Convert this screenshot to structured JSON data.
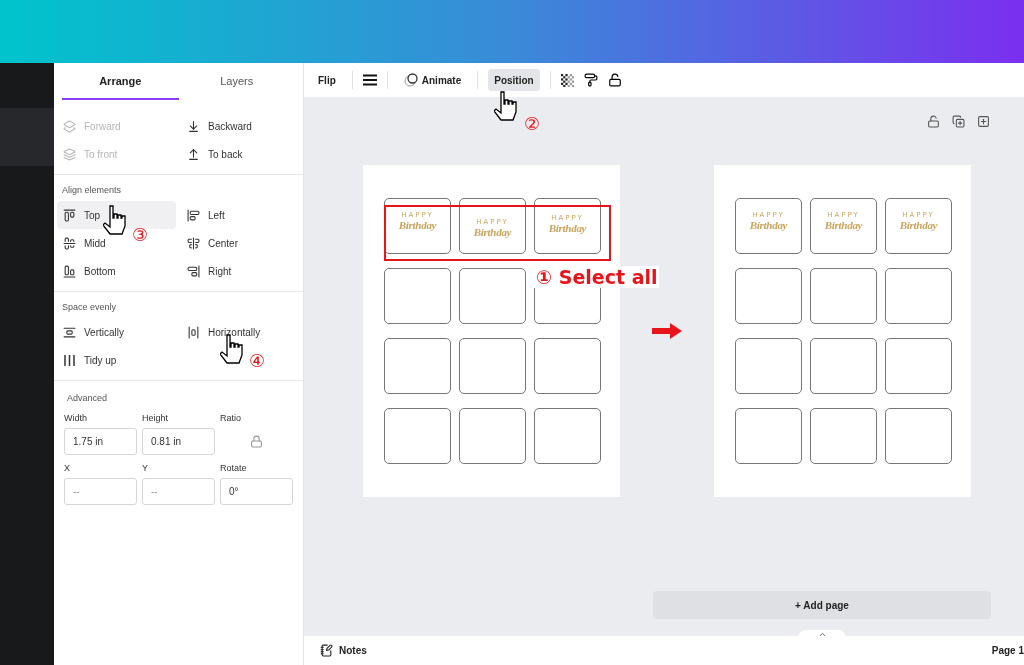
{
  "tabs": [
    {
      "label": "Arrange",
      "selected": true
    },
    {
      "label": "Layers",
      "selected": false
    }
  ],
  "order_actions": [
    {
      "label": "Forward",
      "disabled": true
    },
    {
      "label": "Backward",
      "disabled": false
    },
    {
      "label": "To front",
      "disabled": true
    },
    {
      "label": "To back",
      "disabled": false
    }
  ],
  "align_elements": {
    "title": "Align elements",
    "items": [
      {
        "label": "Top",
        "selected": true
      },
      {
        "label": "Left",
        "selected": false
      },
      {
        "label": "Midd",
        "selected": false
      },
      {
        "label": "Center",
        "selected": false
      },
      {
        "label": "Bottom",
        "selected": false
      },
      {
        "label": "Right",
        "selected": false
      }
    ]
  },
  "space_evenly": {
    "title": "Space evenly",
    "items": [
      {
        "label": "Vertically"
      },
      {
        "label": "Horizontally"
      },
      {
        "label": "Tidy up"
      }
    ]
  },
  "advanced": {
    "title": "Advanced",
    "fields": [
      {
        "kind": "input",
        "label": "Width",
        "value": "1.75 in"
      },
      {
        "kind": "input",
        "label": "Height",
        "value": "0.81 in"
      },
      {
        "kind": "lock",
        "label": "Ratio"
      },
      {
        "kind": "input",
        "label": "X",
        "placeholder": "--"
      },
      {
        "kind": "input",
        "label": "Y",
        "placeholder": "--"
      },
      {
        "kind": "input",
        "label": "Rotate",
        "value": "0°"
      }
    ]
  },
  "toolbar": {
    "flip": "Flip",
    "animate": "Animate",
    "position": {
      "label": "Position",
      "selected": true
    }
  },
  "pages": [
    {
      "selection_box": true,
      "aligned": false,
      "annotation": "① Select all",
      "rows": [
        [
          {
            "kind": "label",
            "top_text": "HAPPY",
            "main_text": "Birthday"
          },
          {
            "kind": "label",
            "top_text": "HAPPY",
            "main_text": "Birthday"
          },
          {
            "kind": "label",
            "top_text": "HAPPY",
            "main_text": "Birthday"
          }
        ],
        [
          {
            "kind": "empty"
          },
          {
            "kind": "empty"
          },
          {
            "kind": "empty"
          }
        ],
        [
          {
            "kind": "empty"
          },
          {
            "kind": "empty"
          },
          {
            "kind": "empty"
          }
        ],
        [
          {
            "kind": "empty"
          },
          {
            "kind": "empty"
          },
          {
            "kind": "empty"
          }
        ]
      ]
    },
    {
      "selection_box": false,
      "aligned": true,
      "rows": [
        [
          {
            "kind": "label",
            "top_text": "HAPPY",
            "main_text": "Birthday"
          },
          {
            "kind": "label",
            "top_text": "HAPPY",
            "main_text": "Birthday"
          },
          {
            "kind": "label",
            "top_text": "HAPPY",
            "main_text": "Birthday"
          }
        ],
        [
          {
            "kind": "empty"
          },
          {
            "kind": "empty"
          },
          {
            "kind": "empty"
          }
        ],
        [
          {
            "kind": "empty"
          },
          {
            "kind": "empty"
          },
          {
            "kind": "empty"
          }
        ],
        [
          {
            "kind": "empty"
          },
          {
            "kind": "empty"
          },
          {
            "kind": "empty"
          }
        ]
      ]
    }
  ],
  "add_page": "+ Add page",
  "notes": "Notes",
  "page_indicator": "Page 1",
  "steps": {
    "position": "②",
    "top": "③",
    "horizontally": "④"
  }
}
